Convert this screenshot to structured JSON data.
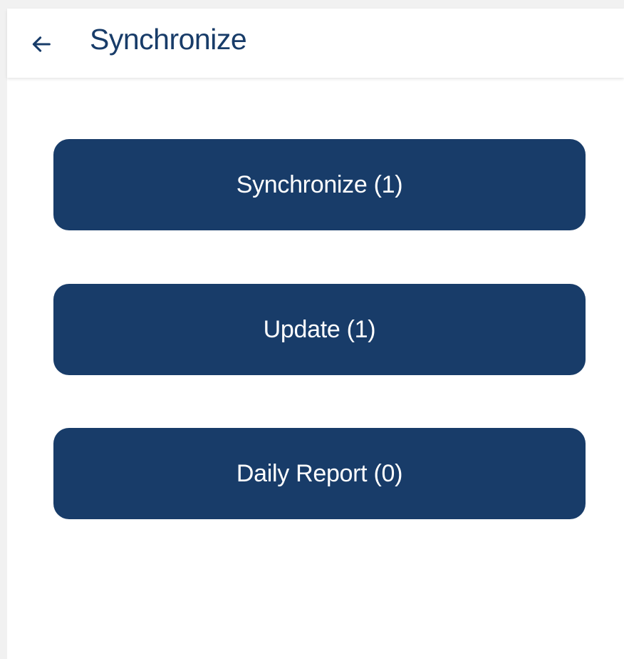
{
  "colors": {
    "primary": "#183c69",
    "button_text": "#ffffff",
    "background": "#ffffff"
  },
  "app_bar": {
    "back_icon": "arrow-left-icon",
    "title": "Synchronize"
  },
  "buttons": [
    {
      "label": "Synchronize (1)"
    },
    {
      "label": "Update (1)"
    },
    {
      "label": "Daily Report (0)"
    }
  ]
}
